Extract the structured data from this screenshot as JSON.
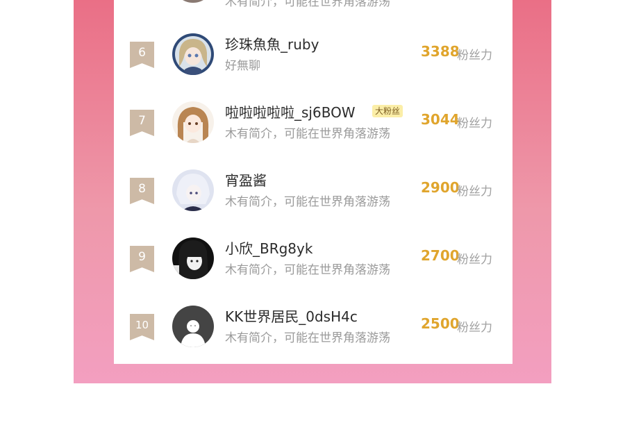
{
  "ranking": {
    "partial_top_bio": "木有简介，可能在世界角落游荡",
    "score_unit": "粉丝力",
    "rows": [
      {
        "rank": "6",
        "name": "珍珠魚魚_ruby",
        "bio": "好無聊",
        "score": "3388",
        "badge": ""
      },
      {
        "rank": "7",
        "name": "啦啦啦啦啦_sj6BOW",
        "bio": "木有简介，可能在世界角落游荡",
        "score": "3044",
        "badge": "大粉丝"
      },
      {
        "rank": "8",
        "name": "宵盈酱",
        "bio": "木有简介，可能在世界角落游荡",
        "score": "2900",
        "badge": ""
      },
      {
        "rank": "9",
        "name": "小欣_BRg8yk",
        "bio": "木有简介，可能在世界角落游荡",
        "score": "2700",
        "badge": ""
      },
      {
        "rank": "10",
        "name": "KK世界居民_0dsH4c",
        "bio": "木有简介，可能在世界角落游荡",
        "score": "2500",
        "badge": ""
      }
    ]
  },
  "colors": {
    "rank_badge": "#cdbaa6",
    "score": "#e0a52d",
    "fan_badge_bg": "#fbeea8",
    "frame_gradient_top": "#ea6f86",
    "frame_gradient_bottom": "#f39fc0"
  },
  "icons": {
    "avatar_default": "default-person-avatar-icon"
  }
}
